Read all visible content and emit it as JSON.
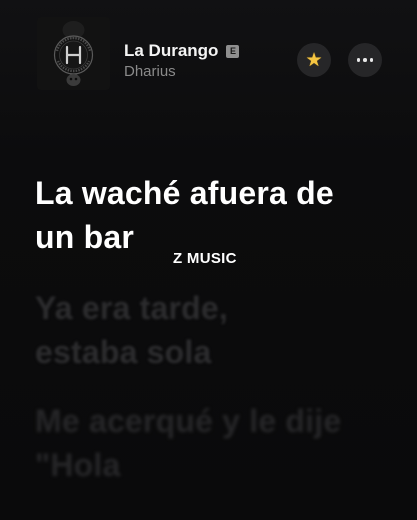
{
  "now_playing": {
    "title": "La Durango",
    "explicit_label": "E",
    "artist": "Dharius"
  },
  "controls": {
    "favorite_icon": "star-icon",
    "more_icon": "ellipsis-icon"
  },
  "lyrics": {
    "active": [
      "La waché afuera de",
      "un bar"
    ],
    "upcoming_1": [
      "Ya era tarde,",
      "estaba sola"
    ],
    "upcoming_2": [
      "Me acerqué y le dije",
      "\"Hola"
    ]
  },
  "watermark": "Z MUSIC",
  "colors": {
    "background": "#0b0b0c",
    "active_lyric": "#ffffff",
    "faded_lyric": "#2c2c2e",
    "artist_text": "#8a8a8a",
    "button_bg": "#262628",
    "star": "#f5c542"
  }
}
